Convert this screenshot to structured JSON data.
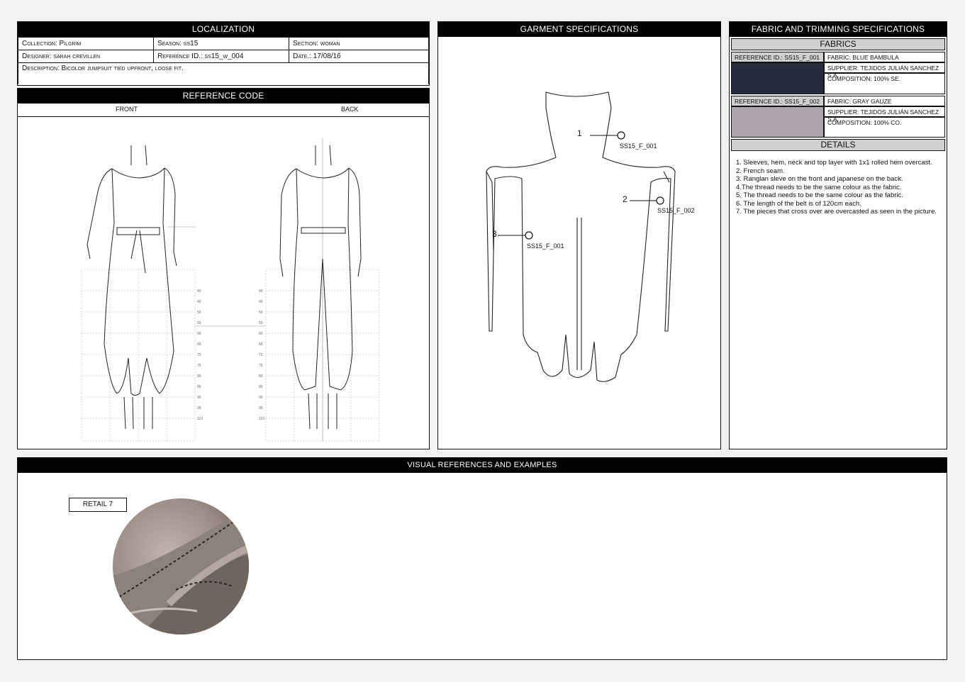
{
  "localization": {
    "header": "LOCALIZATION",
    "collection": "Collection: Pilgrim",
    "season": "Season: ss15",
    "section": "Section: woman",
    "designer": "Designer: sarah crevillen",
    "reference": "Reference ID.: ss15_w_004",
    "date": "Date.: 17/08/16",
    "description": "Description: Bicolor jumpsuit tied upfront, loose fit."
  },
  "reference_code": {
    "header": "REFERENCE CODE",
    "front": "FRONT",
    "back": "BACK"
  },
  "garment": {
    "header": "GARMENT SPECIFICATIONS",
    "callouts": [
      {
        "num": "1",
        "code": "SS15_F_001"
      },
      {
        "num": "2",
        "code": "SS15_F_002"
      },
      {
        "num": "3",
        "code": "SS15_F_001"
      }
    ]
  },
  "fabric_trim": {
    "header": "FABRIC AND TRIMMING SPECIFICATIONS",
    "fabrics_header": "FABRICS",
    "fabrics": [
      {
        "ref": "REFERENCE ID.: SS15_F_001",
        "name": "FABRIC: BLUE BAMBULA",
        "supplier": "SUPPLIER: TEJIDOS JULIÁN SANCHEZ S.A.",
        "composition": "COMPOSITION: 100% SE.",
        "swatch_color": "#262c3e"
      },
      {
        "ref": "REFERENCE ID.: SS15_F_002",
        "name": "FABRIC: GRAY GAUZE",
        "supplier": "SUPPLIER: TEJIDOS JULIÁN SANCHEZ S.A.",
        "composition": "COMPOSITION: 100% CO.",
        "swatch_color": "#ada3ad"
      }
    ],
    "details_header": "DETAILS",
    "details": [
      "1. Sleeves, hem, neck and top layer with 1x1 rolled hem overcast.",
      "2. French seam.",
      "3. Ranglan sleve on the front and japanese on the back.",
      "4.The thread needs to be the same colour as the fabric.",
      "5. The thread needs to be the same colour as the fabric.",
      "6. The length of the belt is of 120cm each.",
      "7. The pieces that cross over are overcasted as seen in the picture."
    ]
  },
  "visual": {
    "header": "VISUAL REFERENCES AND EXAMPLES",
    "retail_label": "RETAIL 7"
  },
  "size_scale": [
    "40",
    "45",
    "50",
    "55",
    "60",
    "65",
    "70",
    "75",
    "80",
    "85",
    "90",
    "95",
    "110"
  ]
}
